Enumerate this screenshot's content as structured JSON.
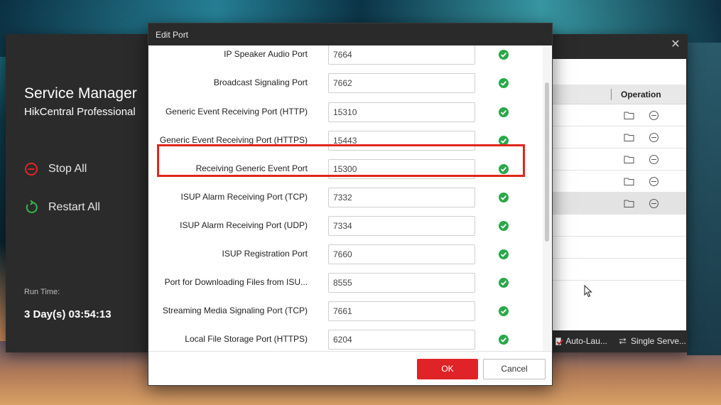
{
  "service_manager": {
    "title": "Service Manager",
    "subtitle": "HikCentral Professional",
    "actions": [
      {
        "label": "Stop All",
        "icon": "stop-icon",
        "color": "#e0262a"
      },
      {
        "label": "Restart All",
        "icon": "restart-icon",
        "color": "#3bb54a"
      }
    ],
    "run_time_label": "Run Time:",
    "run_time_value": "3 Day(s) 03:54:13",
    "close_icon": "close-icon",
    "list": {
      "operation_header": "Operation",
      "rows": [
        {
          "selected": false
        },
        {
          "selected": false
        },
        {
          "selected": false
        },
        {
          "selected": false
        },
        {
          "selected": true
        }
      ]
    },
    "footer": {
      "auto_launch_label": "Auto-Lau...",
      "auto_launch_checked": true,
      "single_server_label": "Single Serve..."
    }
  },
  "dialog": {
    "title": "Edit Port",
    "ports": [
      {
        "label": "IP Speaker Audio Port",
        "value": "7664",
        "valid": true
      },
      {
        "label": "Broadcast Signaling Port",
        "value": "7662",
        "valid": true
      },
      {
        "label": "Generic Event Receiving Port (HTTP)",
        "value": "15310",
        "valid": true
      },
      {
        "label": "Generic Event Receiving Port (HTTPS)",
        "value": "15443",
        "valid": true,
        "highlighted": true
      },
      {
        "label": "Receiving Generic Event Port",
        "value": "15300",
        "valid": true
      },
      {
        "label": "ISUP Alarm Receiving Port (TCP)",
        "value": "7332",
        "valid": true
      },
      {
        "label": "ISUP Alarm Receiving Port (UDP)",
        "value": "7334",
        "valid": true
      },
      {
        "label": "ISUP Registration Port",
        "value": "7660",
        "valid": true
      },
      {
        "label": "Port for Downloading Files from ISU...",
        "value": "8555",
        "valid": true
      },
      {
        "label": "Streaming Media Signaling Port (TCP)",
        "value": "7661",
        "valid": true
      },
      {
        "label": "Local File Storage Port (HTTPS)",
        "value": "6204",
        "valid": true
      }
    ],
    "ok_label": "OK",
    "cancel_label": "Cancel"
  },
  "colors": {
    "accent_red": "#e02327",
    "valid_green": "#2aa84a",
    "highlight_red": "#e0261b"
  }
}
